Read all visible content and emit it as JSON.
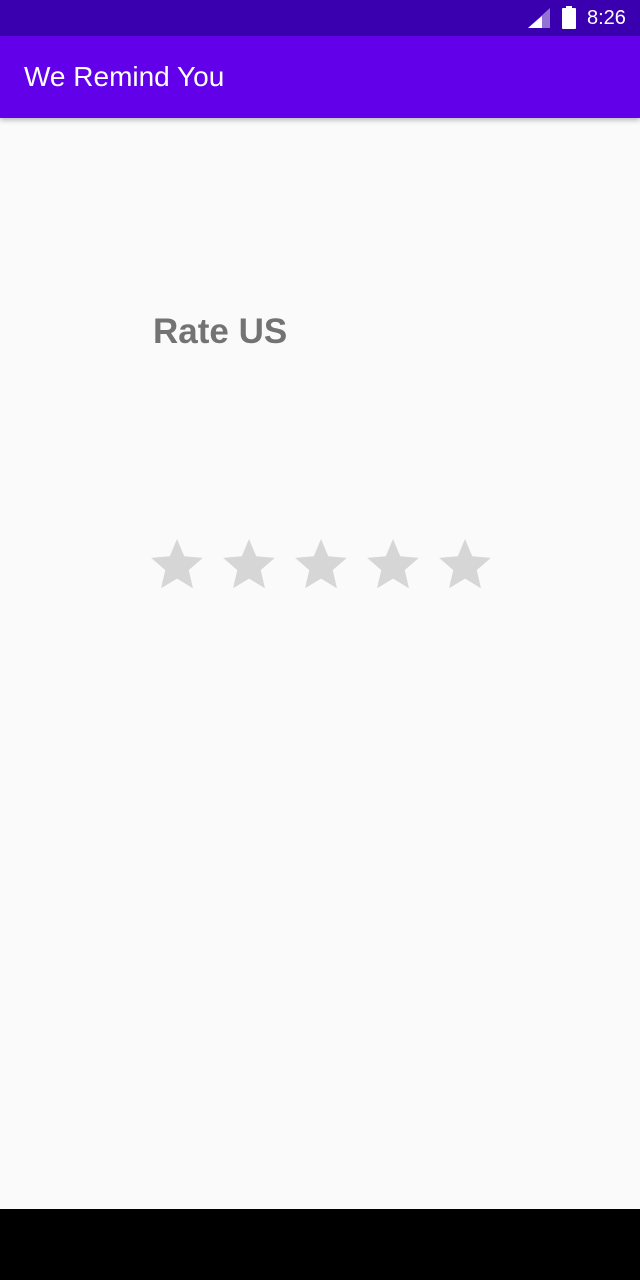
{
  "status_bar": {
    "time": "8:26",
    "background_color": "#3a00b0",
    "icons": [
      "signal-icon",
      "battery-icon"
    ]
  },
  "app_bar": {
    "title": "We Remind You",
    "background_color": "#6200ea"
  },
  "main": {
    "heading": "Rate US",
    "rating": {
      "max_stars": 5,
      "selected": 0,
      "star_color_empty": "#d6d6d6",
      "star_icon": "star-icon"
    }
  },
  "nav_bar": {
    "background_color": "#000000"
  }
}
